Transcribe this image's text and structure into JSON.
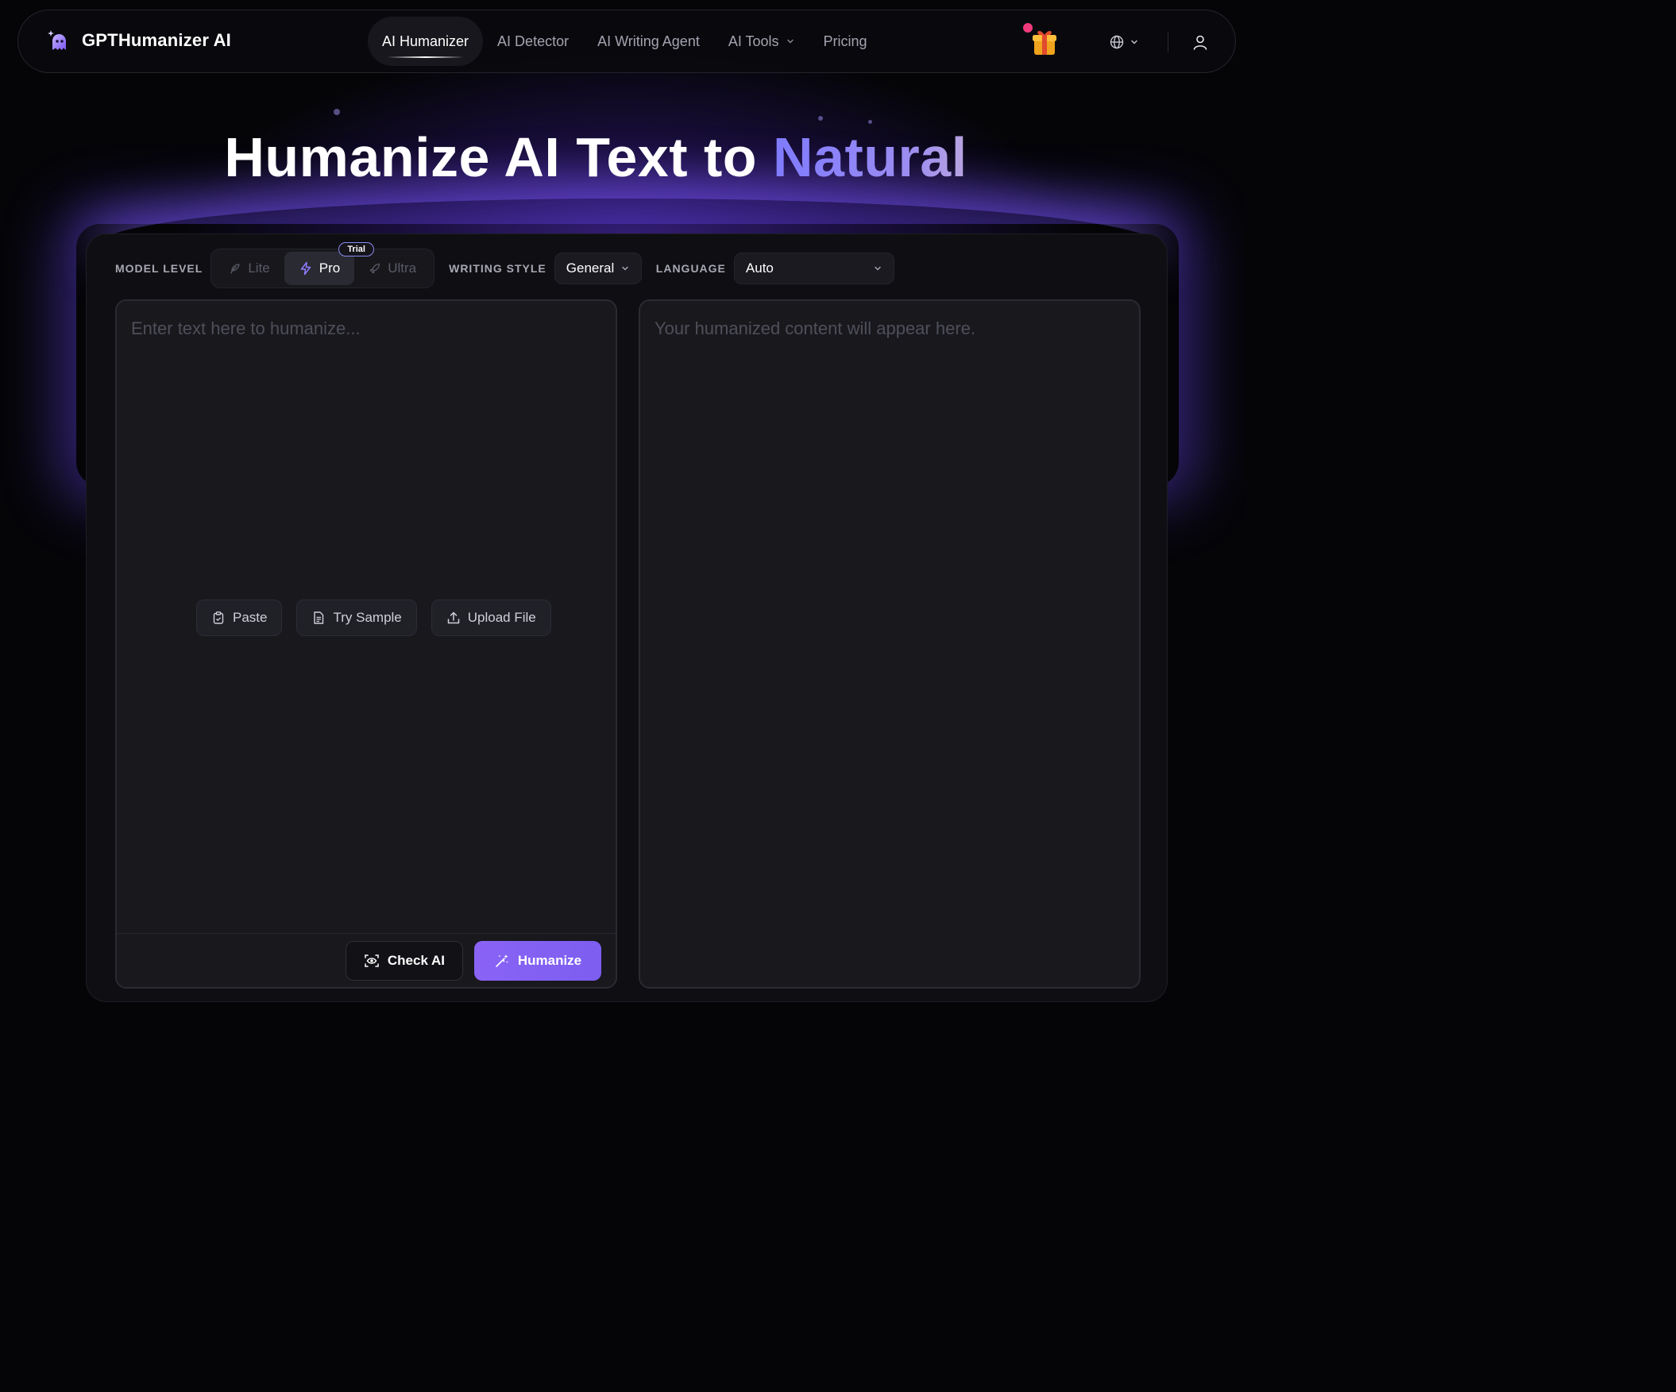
{
  "brand": {
    "name": "GPTHumanizer AI"
  },
  "nav": {
    "links": [
      {
        "label": "AI Humanizer",
        "active": true
      },
      {
        "label": "AI Detector"
      },
      {
        "label": "AI Writing Agent"
      },
      {
        "label": "AI Tools",
        "has_dropdown": true
      },
      {
        "label": "Pricing"
      }
    ],
    "icons": [
      "gift-icon",
      "globe-icon",
      "chevron-down-icon",
      "user-icon"
    ]
  },
  "hero": {
    "title_main": "Humanize AI Text to ",
    "title_accent": "Natural"
  },
  "controls": {
    "model_level_label": "MODEL LEVEL",
    "models": [
      {
        "label": "Lite",
        "icon": "feather-icon"
      },
      {
        "label": "Pro",
        "icon": "lightning-icon",
        "selected": true,
        "badge": "Trial"
      },
      {
        "label": "Ultra",
        "icon": "rocket-icon"
      }
    ],
    "writing_style_label": "WRITING STYLE",
    "writing_style_value": "General",
    "language_label": "LANGUAGE",
    "language_value": "Auto"
  },
  "editor": {
    "placeholder": "Enter text here to humanize...",
    "paste_label": "Paste",
    "sample_label": "Try Sample",
    "upload_label": "Upload File",
    "check_label": "Check AI",
    "humanize_label": "Humanize"
  },
  "output": {
    "placeholder": "Your humanized content will appear here."
  },
  "colors": {
    "accent": "#7c5ef0",
    "background": "#050508",
    "panel": "#0f0f13",
    "notification": "#ef3b7b"
  }
}
